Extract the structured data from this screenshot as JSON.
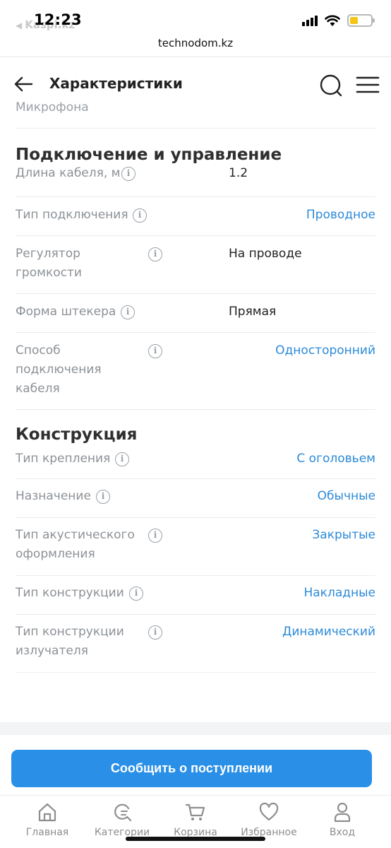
{
  "status_bar": {
    "time": "12:23",
    "back_app": "Kaspi.kz",
    "battery_level": 0.4,
    "battery_color": "#f5c518"
  },
  "browser": {
    "url": "technodom.kz"
  },
  "header": {
    "title": "Характеристики",
    "back_icon": "arrow-left-icon",
    "search_icon": "search-icon",
    "menu_icon": "hamburger-menu-icon"
  },
  "cut_text": "Микрофона",
  "sections": [
    {
      "title": "Подключение и управление",
      "rows": [
        {
          "label": "Длина кабеля, м",
          "value": "1.2",
          "link": false
        },
        {
          "label": "Тип подключения",
          "value": "Проводное",
          "link": true
        },
        {
          "label": "Регулятор громкости",
          "value": "На проводе",
          "link": false
        },
        {
          "label": "Форма штекера",
          "value": "Прямая",
          "link": false
        },
        {
          "label": "Способ подключения кабеля",
          "value": "Односторонний",
          "link": true
        }
      ]
    },
    {
      "title": "Конструкция",
      "rows": [
        {
          "label": "Тип крепления",
          "value": "С оголовьем",
          "link": true
        },
        {
          "label": "Назначение",
          "value": "Обычные",
          "link": true
        },
        {
          "label": "Тип акустического оформления",
          "value": "Закрытые",
          "link": true
        },
        {
          "label": "Тип конструкции",
          "value": "Накладные",
          "link": true
        },
        {
          "label": "Тип конструкции излучателя",
          "value": "Динамический",
          "link": true
        }
      ]
    }
  ],
  "info_icon_glyph": "i",
  "notify_button": "Сообщить о поступлении",
  "bottom_nav": [
    {
      "label": "Главная",
      "icon": "home-icon"
    },
    {
      "label": "Категории",
      "icon": "categories-search-icon"
    },
    {
      "label": "Корзина",
      "icon": "cart-icon"
    },
    {
      "label": "Избранное",
      "icon": "heart-icon"
    },
    {
      "label": "Вход",
      "icon": "user-icon"
    }
  ],
  "colors": {
    "accent": "#2a8fe6",
    "link": "#2b8ad8",
    "label": "#8c9196"
  }
}
